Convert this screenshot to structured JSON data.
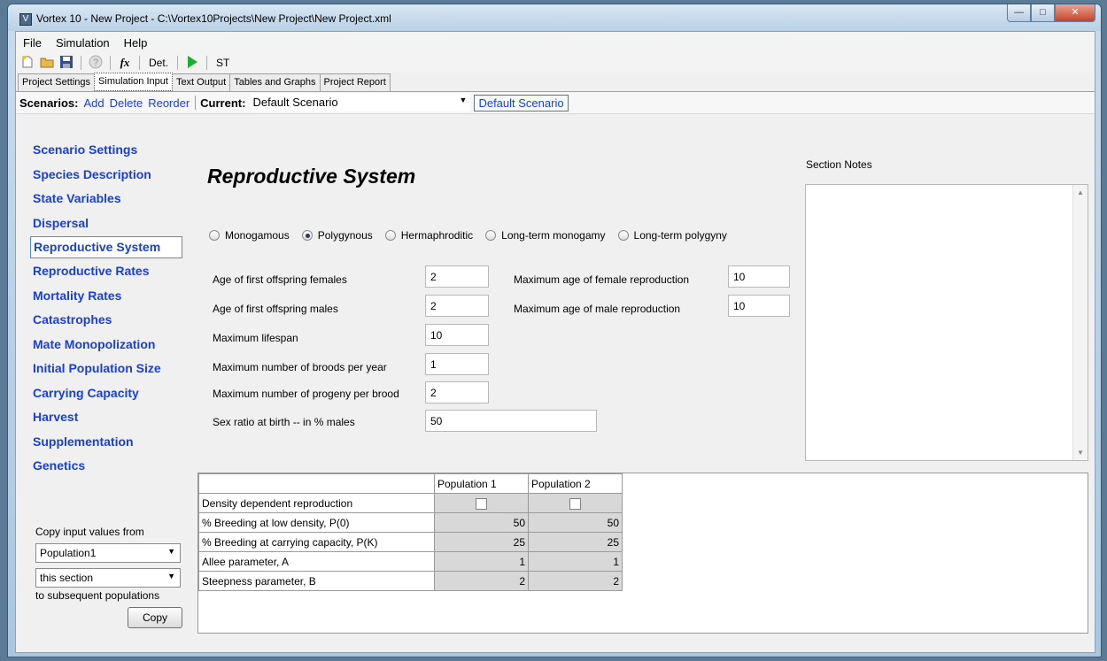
{
  "window": {
    "title": "Vortex 10 - New Project - C:\\Vortex10Projects\\New Project\\New Project.xml"
  },
  "menu": [
    "File",
    "Simulation",
    "Help"
  ],
  "toolbar": {
    "icons": [
      "new-file-icon",
      "open-folder-icon",
      "save-icon",
      "help-icon",
      "function-icon",
      "run-icon"
    ],
    "function_label": "fx",
    "det_label": "Det.",
    "st_label": "ST"
  },
  "tabs": [
    "Project Settings",
    "Simulation Input",
    "Text Output",
    "Tables and Graphs",
    "Project Report"
  ],
  "scenarios": {
    "label": "Scenarios:",
    "add": "Add",
    "delete": "Delete",
    "reorder": "Reorder",
    "current_label": "Current:",
    "current_value": "Default Scenario",
    "name_button": "Default Scenario"
  },
  "nav": {
    "items": [
      "Scenario Settings",
      "Species Description",
      "State Variables",
      "Dispersal",
      "Reproductive System",
      "Reproductive Rates",
      "Mortality Rates",
      "Catastrophes",
      "Mate Monopolization",
      "Initial Population Size",
      "Carrying Capacity",
      "Harvest",
      "Supplementation",
      "Genetics"
    ],
    "active_index": 4
  },
  "copy_panel": {
    "label": "Copy input values from",
    "population_select": "Population1",
    "section_select": "this section",
    "to_label": "to subsequent populations",
    "button": "Copy"
  },
  "section": {
    "title": "Reproductive System",
    "mating_options": [
      "Monogamous",
      "Polygynous",
      "Hermaphroditic",
      "Long-term monogamy",
      "Long-term polygyny"
    ],
    "mating_selected": "Polygynous",
    "fields": {
      "age_first_females_label": "Age of first offspring females",
      "age_first_females": "2",
      "age_first_males_label": "Age of first offspring males",
      "age_first_males": "2",
      "max_lifespan_label": "Maximum lifespan",
      "max_lifespan": "10",
      "max_broods_label": "Maximum number of broods per year",
      "max_broods": "1",
      "max_progeny_label": "Maximum number of progeny per brood",
      "max_progeny": "2",
      "sex_ratio_label": "Sex ratio at birth -- in % males",
      "sex_ratio": "50",
      "max_age_female_label": "Maximum age of female reproduction",
      "max_age_female": "10",
      "max_age_male_label": "Maximum age of male reproduction",
      "max_age_male": "10"
    }
  },
  "notes": {
    "label": "Section Notes",
    "value": ""
  },
  "grid": {
    "columns": [
      "Population 1",
      "Population 2"
    ],
    "rows": [
      {
        "label": "Density dependent reproduction",
        "p1": "",
        "p2": "",
        "type": "checkbox"
      },
      {
        "label": "% Breeding at low density, P(0)",
        "p1": "50",
        "p2": "50"
      },
      {
        "label": "% Breeding at carrying capacity, P(K)",
        "p1": "25",
        "p2": "25"
      },
      {
        "label": "Allee parameter, A",
        "p1": "1",
        "p2": "1"
      },
      {
        "label": "Steepness parameter, B",
        "p1": "2",
        "p2": "2"
      }
    ]
  }
}
